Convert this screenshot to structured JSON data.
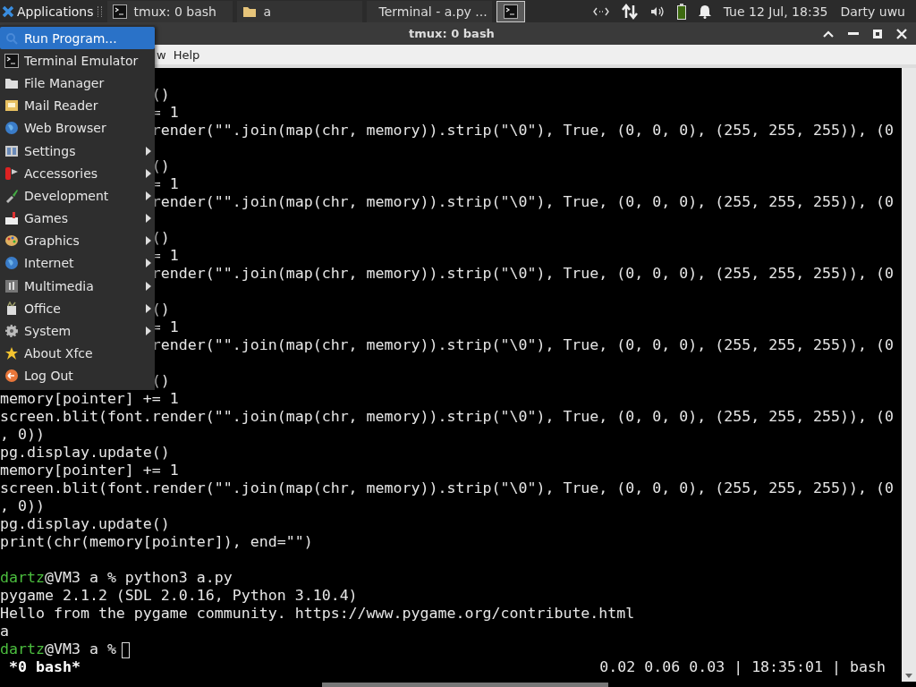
{
  "panel": {
    "apps_label": "Applications",
    "tasks": [
      {
        "label": "tmux: 0 bash",
        "kind": "terminal",
        "selected": false
      },
      {
        "label": "a",
        "kind": "folder",
        "selected": false
      },
      {
        "label": "Terminal - a.py ...",
        "kind": "terminal",
        "selected": false
      },
      {
        "kind": "terminal",
        "selected": true
      }
    ],
    "clock": "Tue 12 Jul, 18:35",
    "user": "Darty uwu"
  },
  "window": {
    "title": "tmux: 0 bash"
  },
  "menubar": [
    "w",
    "Help"
  ],
  "app_menu": [
    {
      "label": "Run Program...",
      "selected": true,
      "submenu": false
    },
    {
      "label": "Terminal Emulator",
      "selected": false,
      "submenu": false
    },
    {
      "label": "File Manager",
      "selected": false,
      "submenu": false
    },
    {
      "label": "Mail Reader",
      "selected": false,
      "submenu": false
    },
    {
      "label": "Web Browser",
      "selected": false,
      "submenu": false
    },
    {
      "label": "Settings",
      "selected": false,
      "submenu": true
    },
    {
      "label": "Accessories",
      "selected": false,
      "submenu": true
    },
    {
      "label": "Development",
      "selected": false,
      "submenu": true
    },
    {
      "label": "Games",
      "selected": false,
      "submenu": true
    },
    {
      "label": "Graphics",
      "selected": false,
      "submenu": true
    },
    {
      "label": "Internet",
      "selected": false,
      "submenu": true
    },
    {
      "label": "Multimedia",
      "selected": false,
      "submenu": true
    },
    {
      "label": "Office",
      "selected": false,
      "submenu": true
    },
    {
      "label": "System",
      "selected": false,
      "submenu": true
    },
    {
      "label": "About Xfce",
      "selected": false,
      "submenu": false
    },
    {
      "label": "Log Out",
      "selected": false,
      "submenu": false
    }
  ],
  "terminal": {
    "lines": [
      {
        "kind": "blank"
      },
      {
        "kind": "partial",
        "text": "()"
      },
      {
        "kind": "partial",
        "text": "= 1"
      },
      {
        "kind": "partial",
        "text": "render(\"\".join(map(chr, memory)).strip(\"\\0\"), True, (0, 0, 0), (255, 255, 255)), (0"
      },
      {
        "kind": "blank"
      },
      {
        "kind": "partial",
        "text": "()"
      },
      {
        "kind": "partial",
        "text": "= 1"
      },
      {
        "kind": "partial",
        "text": "render(\"\".join(map(chr, memory)).strip(\"\\0\"), True, (0, 0, 0), (255, 255, 255)), (0"
      },
      {
        "kind": "blank"
      },
      {
        "kind": "partial",
        "text": "()"
      },
      {
        "kind": "partial",
        "text": "= 1"
      },
      {
        "kind": "partial",
        "text": "render(\"\".join(map(chr, memory)).strip(\"\\0\"), True, (0, 0, 0), (255, 255, 255)), (0"
      },
      {
        "kind": "blank"
      },
      {
        "kind": "partial",
        "text": "()"
      },
      {
        "kind": "partial",
        "text": "= 1"
      },
      {
        "kind": "partial",
        "text": "render(\"\".join(map(chr, memory)).strip(\"\\0\"), True, (0, 0, 0), (255, 255, 255)), (0"
      },
      {
        "kind": "blank"
      },
      {
        "kind": "partial",
        "text": "()"
      },
      {
        "kind": "full",
        "text": "memory[pointer] += 1"
      },
      {
        "kind": "full",
        "text": "screen.blit(font.render(\"\".join(map(chr, memory)).strip(\"\\0\"), True, (0, 0, 0), (255, 255, 255)), (0"
      },
      {
        "kind": "full",
        "text": ", 0))"
      },
      {
        "kind": "full",
        "text": "pg.display.update()"
      },
      {
        "kind": "full",
        "text": "memory[pointer] += 1"
      },
      {
        "kind": "full",
        "text": "screen.blit(font.render(\"\".join(map(chr, memory)).strip(\"\\0\"), True, (0, 0, 0), (255, 255, 255)), (0"
      },
      {
        "kind": "full",
        "text": ", 0))"
      },
      {
        "kind": "full",
        "text": "pg.display.update()"
      },
      {
        "kind": "full",
        "text": "print(chr(memory[pointer]), end=\"\")"
      },
      {
        "kind": "blank"
      },
      {
        "kind": "prompt",
        "user": "dartz",
        "text": "@VM3 a % python3 a.py",
        "cursor": false
      },
      {
        "kind": "full",
        "text": "pygame 2.1.2 (SDL 2.0.16, Python 3.10.4)"
      },
      {
        "kind": "full",
        "text": "Hello from the pygame community. https://www.pygame.org/contribute.html"
      },
      {
        "kind": "full",
        "text": "a"
      },
      {
        "kind": "prompt",
        "user": "dartz",
        "text": "@VM3 a %",
        "cursor": true
      }
    ],
    "status_left": "*0 bash*",
    "status_right": "0.02 0.06 0.03 | 18:35:01 | bash"
  }
}
